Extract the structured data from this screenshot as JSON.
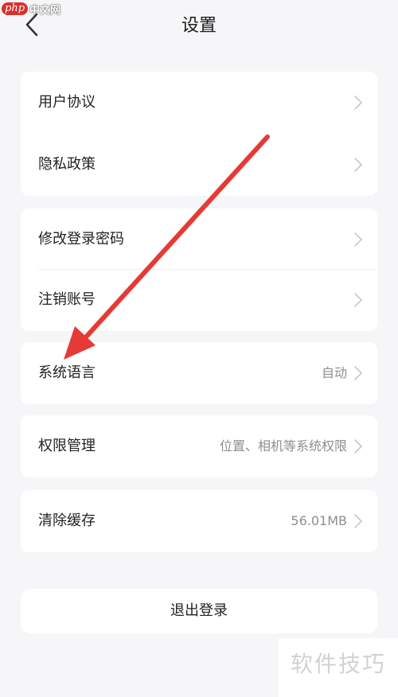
{
  "watermark_top": {
    "logo": "php",
    "text": "中文网"
  },
  "header": {
    "title": "设置"
  },
  "groups": [
    {
      "items": [
        {
          "label": "用户协议",
          "value": ""
        },
        {
          "label": "隐私政策",
          "value": ""
        }
      ]
    },
    {
      "items": [
        {
          "label": "修改登录密码",
          "value": ""
        },
        {
          "label": "注销账号",
          "value": ""
        }
      ]
    },
    {
      "items": [
        {
          "label": "系统语言",
          "value": "自动"
        }
      ]
    },
    {
      "items": [
        {
          "label": "权限管理",
          "value": "位置、相机等系统权限"
        }
      ]
    },
    {
      "items": [
        {
          "label": "清除缓存",
          "value": "56.01MB"
        }
      ]
    }
  ],
  "logout": {
    "label": "退出登录"
  },
  "watermark_bottom": {
    "text": "软件技巧"
  },
  "colors": {
    "background": "#f6f6f8",
    "card": "#ffffff",
    "annotation_arrow": "#e53a35"
  }
}
